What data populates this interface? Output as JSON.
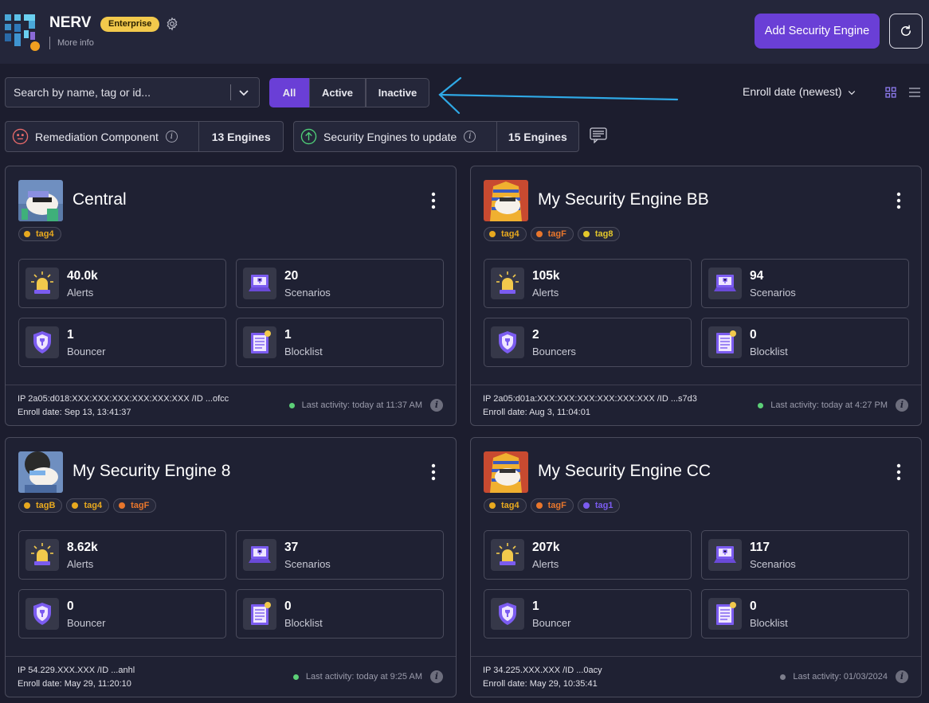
{
  "header": {
    "org_name": "NERV",
    "plan_badge": "Enterprise",
    "more_info": "More info",
    "add_button": "Add Security Engine"
  },
  "filters": {
    "search_placeholder": "Search by name, tag or id...",
    "segments": [
      "All",
      "Active",
      "Inactive"
    ],
    "selected_segment": "All",
    "sort_label": "Enroll date (newest)"
  },
  "summary": {
    "remediation_label": "Remediation Component",
    "remediation_count": "13 Engines",
    "update_label": "Security Engines to update",
    "update_count": "15 Engines"
  },
  "colors": {
    "accent": "#6a3fd6",
    "enterprise_badge": "#f2c94c",
    "active_dot": "#5ccf77",
    "inactive_dot": "#7d7e8c"
  },
  "engines": [
    {
      "name": "Central",
      "avatar": "sunglasses-mascot",
      "tags": [
        {
          "label": "tag4",
          "color": "#e8a91f"
        }
      ],
      "alerts": "40.0k",
      "alerts_label": "Alerts",
      "scenarios": "20",
      "scenarios_label": "Scenarios",
      "bouncers": "1",
      "bouncers_label": "Bouncer",
      "blocklist": "1",
      "blocklist_label": "Blocklist",
      "ip": "IP 2a05:d018:XXX:XXX:XXX:XXX:XXX:XXX /ID ...ofcc",
      "enroll": "Enroll date: Sep 13, 13:41:37",
      "activity": "Last activity: today at 11:37 AM",
      "active": true
    },
    {
      "name": "My Security Engine BB",
      "avatar": "pharaoh-mascot",
      "tags": [
        {
          "label": "tag4",
          "color": "#e8a91f"
        },
        {
          "label": "tagF",
          "color": "#e8762c"
        },
        {
          "label": "tag8",
          "color": "#e3c72b"
        }
      ],
      "alerts": "105k",
      "alerts_label": "Alerts",
      "scenarios": "94",
      "scenarios_label": "Scenarios",
      "bouncers": "2",
      "bouncers_label": "Bouncers",
      "blocklist": "0",
      "blocklist_label": "Blocklist",
      "ip": "IP 2a05:d01a:XXX:XXX:XXX:XXX:XXX:XXX /ID ...s7d3",
      "enroll": "Enroll date: Aug 3, 11:04:01",
      "activity": "Last activity: today at 4:27 PM",
      "active": true
    },
    {
      "name": "My Security Engine 8",
      "avatar": "afro-mascot",
      "tags": [
        {
          "label": "tagB",
          "color": "#e8a91f"
        },
        {
          "label": "tag4",
          "color": "#e8a91f"
        },
        {
          "label": "tagF",
          "color": "#e8762c"
        }
      ],
      "alerts": "8.62k",
      "alerts_label": "Alerts",
      "scenarios": "37",
      "scenarios_label": "Scenarios",
      "bouncers": "0",
      "bouncers_label": "Bouncer",
      "blocklist": "0",
      "blocklist_label": "Blocklist",
      "ip": "IP 54.229.XXX.XXX /ID ...anhl",
      "enroll": "Enroll date: May 29, 11:20:10",
      "activity": "Last activity: today at 9:25 AM",
      "active": true
    },
    {
      "name": "My Security Engine CC",
      "avatar": "pharaoh-mascot",
      "tags": [
        {
          "label": "tag4",
          "color": "#e8a91f"
        },
        {
          "label": "tagF",
          "color": "#e8762c"
        },
        {
          "label": "tag1",
          "color": "#7b5cf0"
        }
      ],
      "alerts": "207k",
      "alerts_label": "Alerts",
      "scenarios": "117",
      "scenarios_label": "Scenarios",
      "bouncers": "1",
      "bouncers_label": "Bouncer",
      "blocklist": "0",
      "blocklist_label": "Blocklist",
      "ip": "IP 34.225.XXX.XXX /ID ...0acy",
      "enroll": "Enroll date: May 29, 10:35:41",
      "activity": "Last activity: 01/03/2024",
      "active": false
    }
  ]
}
